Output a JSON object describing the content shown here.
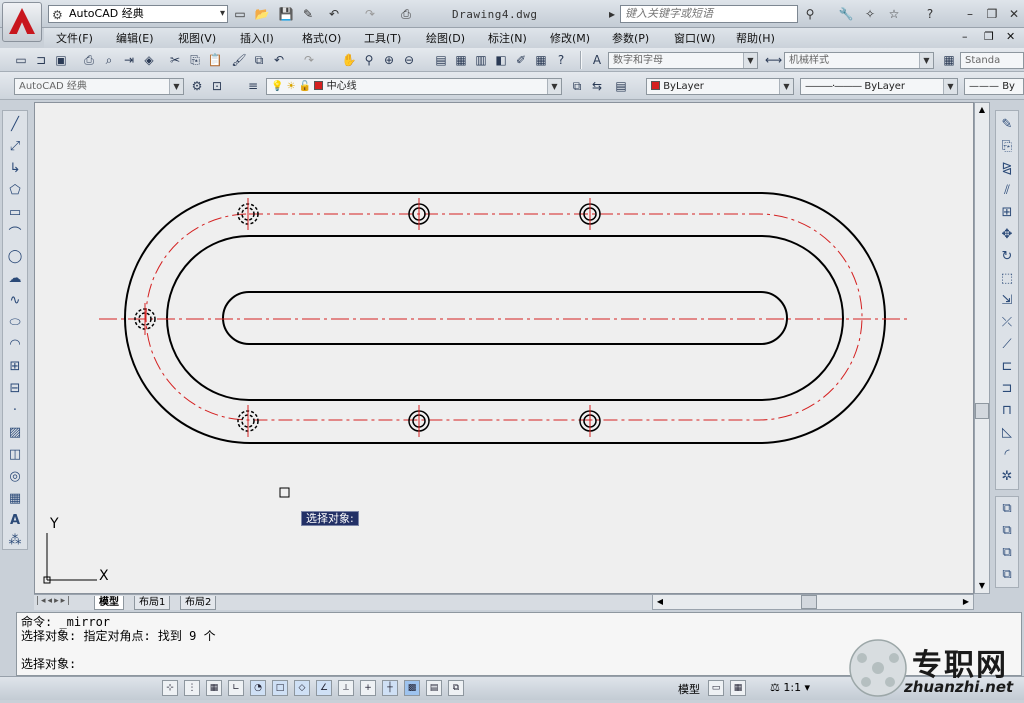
{
  "title_bar": {
    "workspace": "AutoCAD 经典",
    "document": "Drawing4.dwg",
    "search_placeholder": "键入关键字或短语"
  },
  "menu": [
    "文件(F)",
    "编辑(E)",
    "视图(V)",
    "插入(I)",
    "格式(O)",
    "工具(T)",
    "绘图(D)",
    "标注(N)",
    "修改(M)",
    "参数(P)",
    "窗口(W)",
    "帮助(H)"
  ],
  "toolbar1": {
    "text_style": "数字和字母",
    "dim_style": "机械样式",
    "table_style": "Standa"
  },
  "toolbar2": {
    "workspace": "AutoCAD 经典",
    "layer": "中心线",
    "color": "ByLayer",
    "linetype": "ByLayer",
    "lineweight": "By"
  },
  "drawing": {
    "tooltip": "选择对象:",
    "ucs_x": "X",
    "ucs_y": "Y"
  },
  "tabs": {
    "model": "模型",
    "layout1": "布局1",
    "layout2": "布局2"
  },
  "command": {
    "line1": "命令: _mirror",
    "line2": "选择对象: 指定对角点: 找到 9 个",
    "prompt": "选择对象:"
  },
  "status": {
    "model": "模型",
    "scale": "1:1"
  },
  "watermark": {
    "brand": "专职网",
    "url": "zhuanzhi.net"
  },
  "colors": {
    "centerline": "#d42020",
    "outline": "#000000"
  }
}
